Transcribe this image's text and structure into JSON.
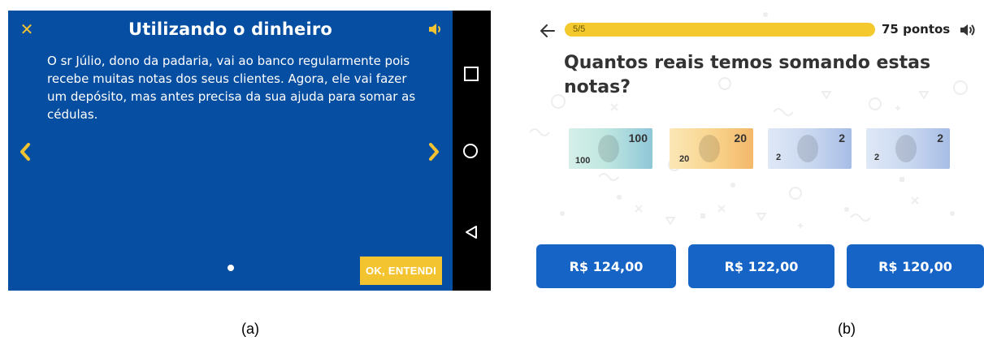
{
  "panel_a": {
    "title": "Utilizando o dinheiro",
    "text": "O sr Júlio, dono da padaria, vai ao banco regularmente pois recebe muitas notas dos seus clientes. Agora, ele vai fazer um depósito, mas antes precisa da sua ajuda para somar as cédulas.",
    "ok_label": "OK, ENTENDI",
    "close_glyph": "✕",
    "icons": [
      "close-icon",
      "speaker-icon",
      "chevron-left-icon",
      "chevron-right-icon",
      "nav-recents-icon",
      "nav-home-icon",
      "nav-back-icon"
    ],
    "colors": {
      "background": "#064ea1",
      "accent": "#f4c430",
      "nav_bar": "#000000"
    }
  },
  "panel_b": {
    "progress_label": "5/5",
    "progress_fraction": 1.0,
    "points": "75 pontos",
    "question": "Quantos reais temos somando estas notas?",
    "notes": [
      {
        "value": "100",
        "small": "100"
      },
      {
        "value": "20",
        "small": "20"
      },
      {
        "value": "2",
        "small": "2"
      },
      {
        "value": "2",
        "small": "2"
      }
    ],
    "answers": [
      "R$ 124,00",
      "R$ 122,00",
      "R$ 120,00"
    ],
    "icons": [
      "back-arrow-icon",
      "speaker-icon"
    ],
    "colors": {
      "progress": "#f3c92d",
      "button": "#1664c6"
    }
  },
  "captions": {
    "a": "(a)",
    "b": "(b)"
  }
}
